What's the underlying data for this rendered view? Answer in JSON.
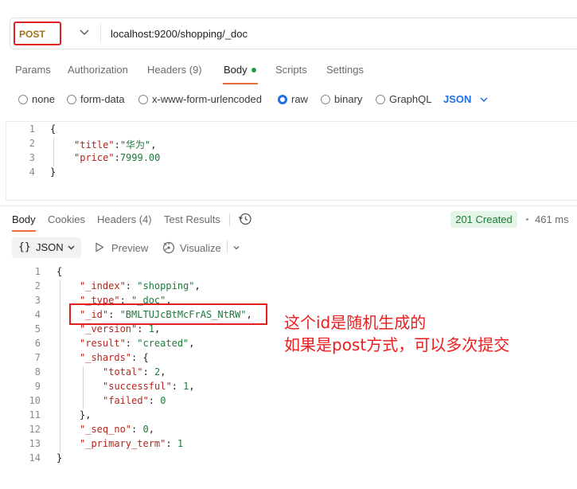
{
  "request": {
    "method": "POST",
    "url": "localhost:9200/shopping/_doc"
  },
  "request_tabs": [
    "Params",
    "Authorization",
    "Headers (9)",
    "Body",
    "Scripts",
    "Settings"
  ],
  "body_types": [
    "none",
    "form-data",
    "x-www-form-urlencoded",
    "raw",
    "binary",
    "GraphQL"
  ],
  "body_type_selected": "raw",
  "body_format": "JSON",
  "request_body": {
    "line_numbers": [
      "1",
      "2",
      "3",
      "4"
    ],
    "l1": "{",
    "title_key": "\"title\"",
    "colon": ":",
    "title_value": "\"华为\"",
    "comma": ",",
    "price_key": "\"price\"",
    "price_value": "7999.00",
    "l4": "}"
  },
  "response_tabs": [
    "Body",
    "Cookies",
    "Headers (4)",
    "Test Results"
  ],
  "response_status": "201 Created",
  "response_time": "461 ms",
  "response_view": {
    "format_braces": "{}",
    "format": "JSON",
    "preview": "Preview",
    "visualize": "Visualize"
  },
  "response_body": {
    "line_numbers": [
      "1",
      "2",
      "3",
      "4",
      "5",
      "6",
      "7",
      "8",
      "9",
      "10",
      "11",
      "12",
      "13",
      "14"
    ],
    "open": "{",
    "index_key": "\"_index\"",
    "index_val": "\"shopping\"",
    "type_key": "\"_type\"",
    "type_val": "\"_doc\"",
    "id_key": "\"_id\"",
    "id_val": "\"BMLTUJcBtMcFrAS_NtRW\"",
    "version_key": "\"_version\"",
    "version_val": "1",
    "result_key": "\"result\"",
    "result_val": "\"created\"",
    "shards_key": "\"_shards\"",
    "shards_open": "{",
    "total_key": "\"total\"",
    "total_val": "2",
    "successful_key": "\"successful\"",
    "successful_val": "1",
    "failed_key": "\"failed\"",
    "failed_val": "0",
    "shards_close": "},",
    "seq_key": "\"_seq_no\"",
    "seq_val": "0",
    "primary_key": "\"_primary_term\"",
    "primary_val": "1",
    "close": "}",
    "sep": ": ",
    "comma": ",",
    "sep_brace": ": "
  },
  "annotation": {
    "line1": "这个id是随机生成的",
    "line2": "如果是post方式，可以多次提交"
  },
  "colors": {
    "accent": "#f26b3a",
    "method": "#a4701b",
    "highlight": "#e02020",
    "json_link": "#1f6fe5",
    "status_bg": "#e5f6e8",
    "status_text": "#1d7a3a"
  }
}
